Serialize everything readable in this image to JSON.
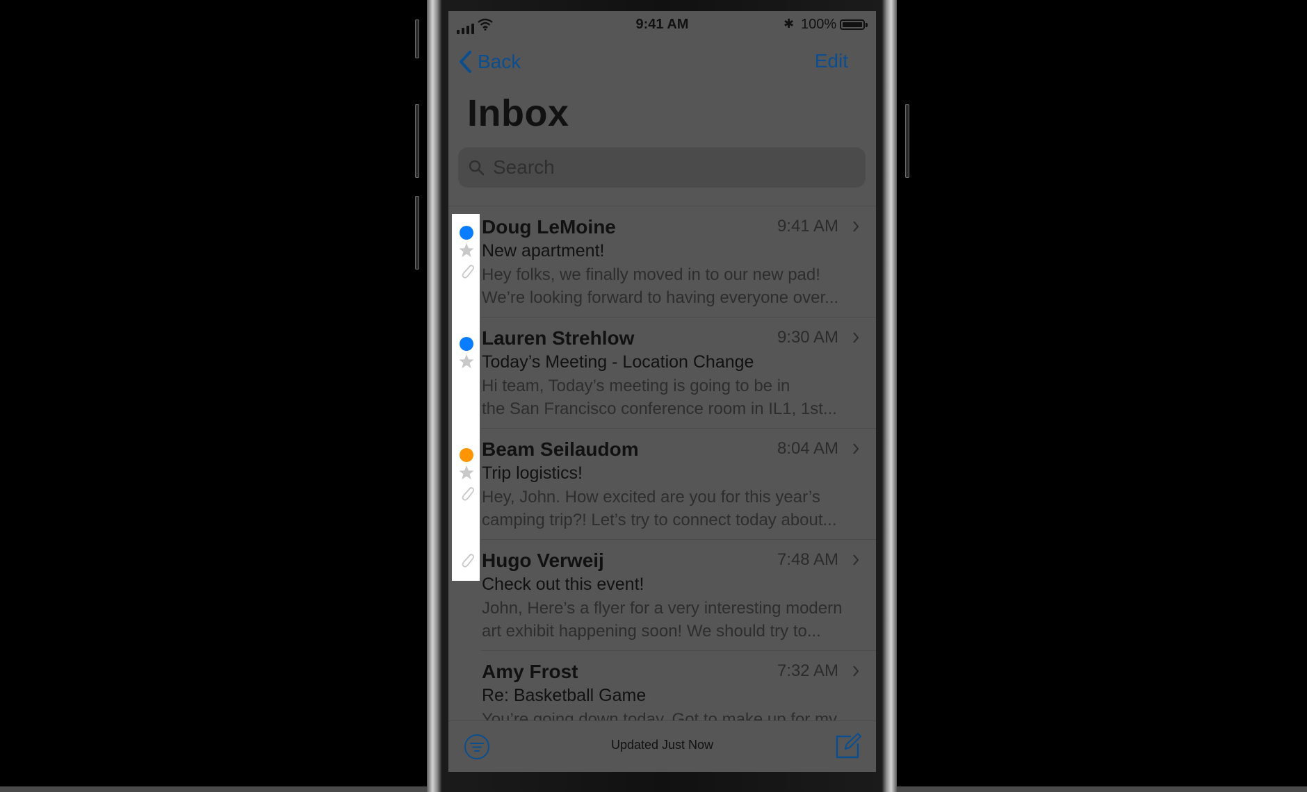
{
  "status_bar": {
    "time": "9:41 AM",
    "battery": "100%"
  },
  "nav": {
    "back_label": "Back",
    "edit_label": "Edit"
  },
  "title": "Inbox",
  "search": {
    "placeholder": "Search"
  },
  "messages": [
    {
      "sender": "Doug LeMoine",
      "time": "9:41 AM",
      "subject": "New apartment!",
      "preview_line1": "Hey folks, we finally moved in to our new pad!",
      "preview_line2": "We’re looking forward to having everyone over...",
      "unread": true,
      "dot_color": "#0a7cff",
      "flagged": true,
      "attachment": true
    },
    {
      "sender": "Lauren Strehlow",
      "time": "9:30 AM",
      "subject": "Today’s Meeting - Location Change",
      "preview_line1": "Hi team, Today’s meeting is going to be in",
      "preview_line2": "the San Francisco conference room in IL1, 1st...",
      "unread": true,
      "dot_color": "#0a7cff",
      "flagged": true,
      "attachment": false
    },
    {
      "sender": "Beam Seilaudom",
      "time": "8:04 AM",
      "subject": "Trip logistics!",
      "preview_line1": "Hey, John. How excited are you for this year’s",
      "preview_line2": "camping trip?! Let’s try to connect today about...",
      "unread": true,
      "dot_color": "#ff9500",
      "flagged": true,
      "attachment": true
    },
    {
      "sender": "Hugo Verweij",
      "time": "7:48 AM",
      "subject": "Check out this event!",
      "preview_line1": "John, Here’s a flyer for a very interesting modern",
      "preview_line2": "art exhibit happening soon! We should try to...",
      "unread": false,
      "flagged": false,
      "attachment": true
    },
    {
      "sender": "Amy Frost",
      "time": "7:32 AM",
      "subject": "Re: Basketball Game",
      "preview_line1": "You’re going down today. Got to make up for my",
      "preview_line2": "",
      "unread": false,
      "flagged": false,
      "attachment": false
    }
  ],
  "toolbar": {
    "status": "Updated Just Now",
    "filter_icon": "filter-icon",
    "compose_icon": "compose-icon"
  },
  "colors": {
    "accent": "#0a7cff",
    "vip_orange": "#ff9500",
    "dimmed_screen": "#565656"
  }
}
